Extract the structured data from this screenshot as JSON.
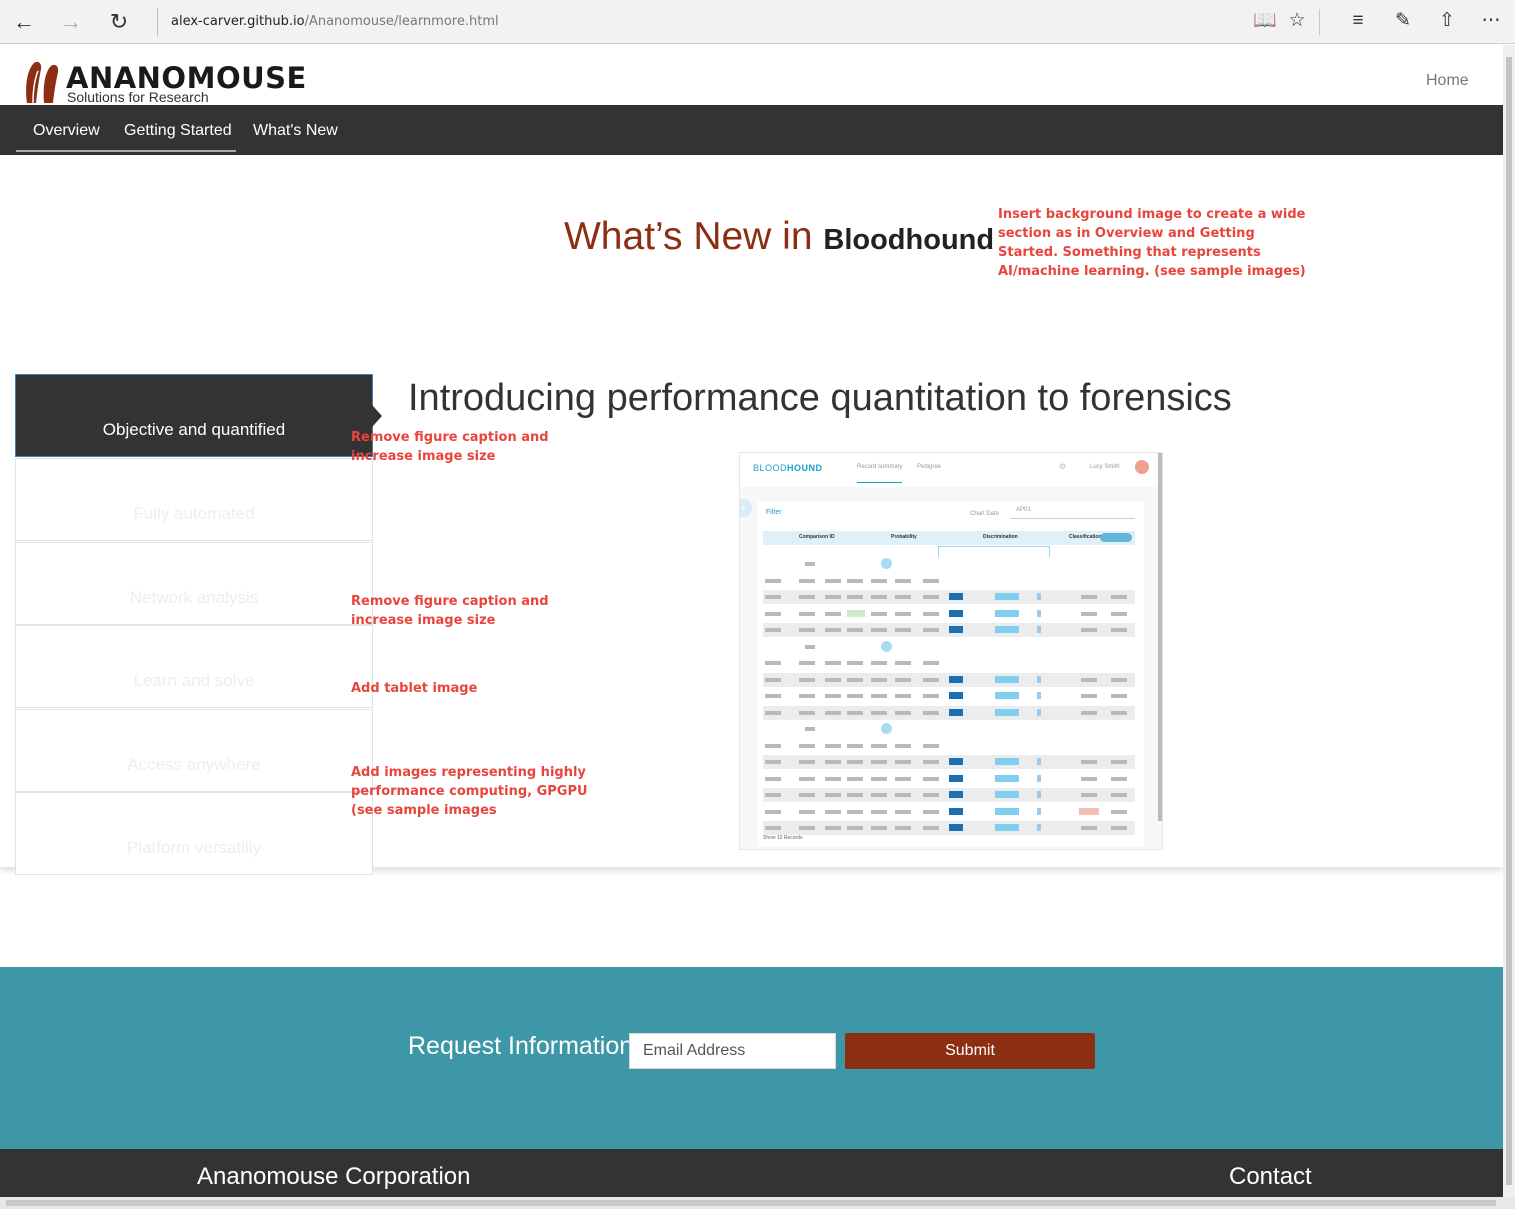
{
  "browser": {
    "url_host": "alex-carver.github.io",
    "url_path": "/Ananomouse/learnmore.html",
    "icons": [
      "back-arrow-icon",
      "forward-arrow-icon",
      "refresh-icon",
      "reading-view-icon",
      "favorite-star-icon",
      "hub-icon",
      "web-note-icon",
      "share-icon",
      "more-icon"
    ]
  },
  "header": {
    "brand": "ANANOMOUSE",
    "tagline": "Solutions for Research",
    "home_link": "Home"
  },
  "subnav": {
    "items": [
      "Overview",
      "Getting Started",
      "What's New"
    ],
    "underlined": "Getting Started"
  },
  "main": {
    "headline_prefix": "What’s New in",
    "headline_product": "Bloodhound",
    "section_title": "Introducing performance quantitation to forensics",
    "tabs": [
      {
        "label": "Objective and quantified",
        "active": true
      },
      {
        "label": "Fully automated",
        "active": false
      },
      {
        "label": "Network analysis",
        "active": false
      },
      {
        "label": "Learn and solve",
        "active": false
      },
      {
        "label": "Access anywhere",
        "active": false
      },
      {
        "label": "Platform versatiliy",
        "active": false
      }
    ],
    "notes": {
      "background": "Insert background image to create a wide section as in Overview and Getting Started. Something that represents AI/machine learning. (see sample images)",
      "caption1": "Remove figure caption and increase image size",
      "caption2": "Remove figure caption and increase image size",
      "tablet": "Add tablet image",
      "hpc": "Add images representing highly performance computing, GPGPU (see sample images"
    },
    "note_color": "#e8453c",
    "figure": {
      "brand_light": "BLOOD",
      "brand_bold": "HOUND",
      "tab1": "Record summary",
      "tab2": "Pedigree",
      "user": "Lucy Smith",
      "filter": "Filter",
      "chart_date": "Chart Date",
      "search": "AP01",
      "columns": [
        "Comparison ID",
        "Probability",
        "Discrimination",
        "Classification"
      ],
      "footer": "Show 10 Records"
    }
  },
  "request": {
    "label": "Request Information",
    "email_placeholder": "Email Address",
    "submit": "Submit"
  },
  "footer": {
    "corp": "Ananomouse Corporation",
    "contact": "Contact"
  },
  "colors": {
    "brand_red": "#8b2e12",
    "teal": "#3e97a7",
    "dark": "#333333"
  }
}
